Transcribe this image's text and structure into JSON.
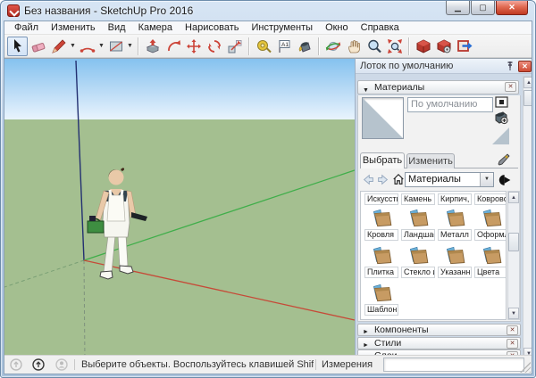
{
  "window": {
    "title": "Без названия - SketchUp Pro 2016"
  },
  "menu": {
    "items": [
      "Файл",
      "Изменить",
      "Вид",
      "Камера",
      "Нарисовать",
      "Инструменты",
      "Окно",
      "Справка"
    ]
  },
  "toolbar": {
    "tool_icons": [
      "select",
      "eraser",
      "line",
      "arcs",
      "shapes",
      "push-pull",
      "offset",
      "move",
      "rotate",
      "scale",
      "tape-measure",
      "text",
      "paint-bucket",
      "orbit",
      "pan",
      "zoom",
      "zoom-extents",
      "3d-warehouse",
      "extension-warehouse",
      "send-to-layout"
    ],
    "active_tool": "select"
  },
  "tray": {
    "title": "Лоток по умолчанию",
    "materials": {
      "title": "Материалы",
      "current_material": "По умолчанию",
      "tabs": {
        "select": "Выбрать",
        "edit": "Изменить"
      },
      "collection": "Материалы",
      "categories": [
        "Искусств",
        "Камень",
        "Кирпич,",
        "Коврово",
        "Кровля",
        "Ландшаф",
        "Металл",
        "Оформле",
        "Плитка",
        "Стекло и",
        "Указанн",
        "Цвета",
        "Шаблоны"
      ]
    },
    "sections": [
      "Компоненты",
      "Стили",
      "Слои"
    ]
  },
  "statusbar": {
    "message": "Выберите объекты. Воспользуйтесь клавишей Shift, чтобы увелич...",
    "measurements_label": "Измерения",
    "measurements_value": ""
  },
  "viewport": {
    "colors": {
      "sky_top": "#85c2ef",
      "sky_horizon": "#e9f4fd",
      "ground": "#a4bf90",
      "axis_red": "#c64a38",
      "axis_green": "#3fae4a",
      "axis_blue": "#233071"
    }
  },
  "colors": {
    "close_button": "#ce4a33",
    "folder": "#c79b63",
    "accent_red": "#cc4438"
  }
}
